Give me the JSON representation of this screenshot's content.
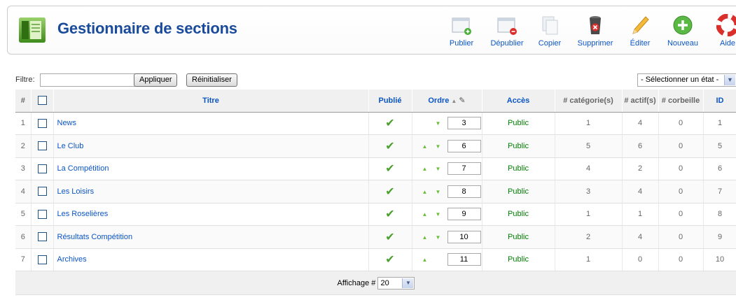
{
  "header": {
    "title": "Gestionnaire de sections",
    "toolbar": [
      {
        "id": "publish",
        "label": "Publier",
        "icon": "publish-icon"
      },
      {
        "id": "unpublish",
        "label": "Dépublier",
        "icon": "unpublish-icon"
      },
      {
        "id": "copy",
        "label": "Copier",
        "icon": "copy-icon"
      },
      {
        "id": "delete",
        "label": "Supprimer",
        "icon": "trash-icon"
      },
      {
        "id": "edit",
        "label": "Éditer",
        "icon": "pencil-icon"
      },
      {
        "id": "new",
        "label": "Nouveau",
        "icon": "add-icon"
      },
      {
        "id": "help",
        "label": "Aide",
        "icon": "lifebuoy-icon"
      }
    ]
  },
  "filter": {
    "label": "Filtre:",
    "value": "",
    "apply_label": "Appliquer",
    "reset_label": "Réinitialiser",
    "state_select": "- Sélectionner un état -"
  },
  "table": {
    "columns": {
      "num": "#",
      "title": "Titre",
      "published": "Publié",
      "order": "Ordre",
      "access": "Accès",
      "categories": "# catégorie(s)",
      "active": "# actif(s)",
      "trash": "# corbeille",
      "id": "ID"
    },
    "rows": [
      {
        "num": "1",
        "title": "News",
        "order": "3",
        "access": "Public",
        "categories": "1",
        "active": "4",
        "trash": "0",
        "id": "1",
        "up": false,
        "down": true
      },
      {
        "num": "2",
        "title": "Le Club",
        "order": "6",
        "access": "Public",
        "categories": "5",
        "active": "6",
        "trash": "0",
        "id": "5",
        "up": true,
        "down": true
      },
      {
        "num": "3",
        "title": "La Compétition",
        "order": "7",
        "access": "Public",
        "categories": "4",
        "active": "2",
        "trash": "0",
        "id": "6",
        "up": true,
        "down": true
      },
      {
        "num": "4",
        "title": "Les Loisirs",
        "order": "8",
        "access": "Public",
        "categories": "3",
        "active": "4",
        "trash": "0",
        "id": "7",
        "up": true,
        "down": true
      },
      {
        "num": "5",
        "title": "Les Roselières",
        "order": "9",
        "access": "Public",
        "categories": "1",
        "active": "1",
        "trash": "0",
        "id": "8",
        "up": true,
        "down": true
      },
      {
        "num": "6",
        "title": "Résultats Compétition",
        "order": "10",
        "access": "Public",
        "categories": "2",
        "active": "4",
        "trash": "0",
        "id": "9",
        "up": true,
        "down": true
      },
      {
        "num": "7",
        "title": "Archives",
        "order": "11",
        "access": "Public",
        "categories": "1",
        "active": "0",
        "trash": "0",
        "id": "10",
        "up": true,
        "down": false
      }
    ]
  },
  "footer": {
    "display_label": "Affichage #",
    "display_value": "20"
  },
  "colors": {
    "link": "#0b55c4",
    "title": "#1a4b9a",
    "access": "#008000",
    "check": "#4aa02c"
  }
}
